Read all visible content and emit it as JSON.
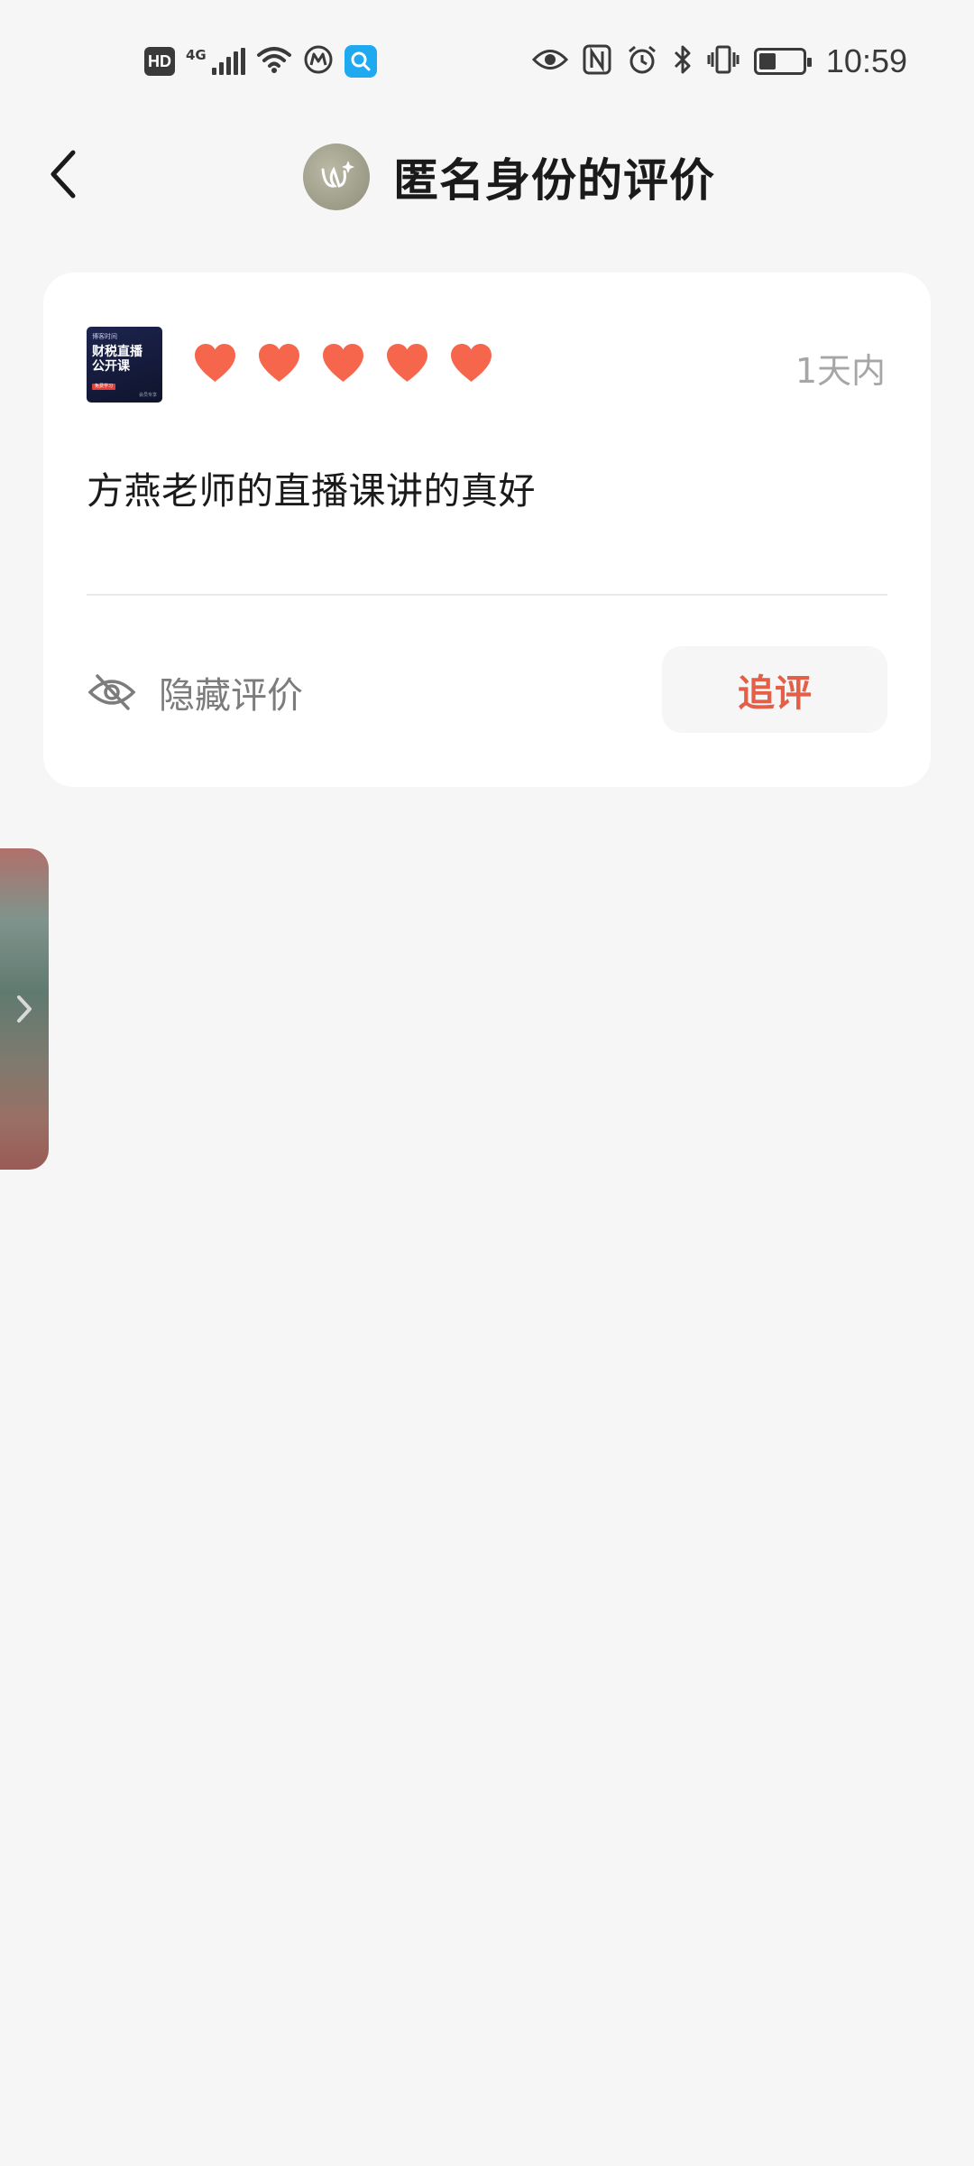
{
  "status_bar": {
    "hd_label": "HD",
    "network_label": "4G",
    "time": "10:59",
    "icons": [
      "hd-icon",
      "signal-icon",
      "wifi-icon",
      "metro-icon",
      "search-app-icon",
      "eye-icon",
      "nfc-icon",
      "alarm-icon",
      "bluetooth-icon",
      "vibrate-icon",
      "battery-icon"
    ],
    "battery_level": 0.4
  },
  "header": {
    "title": "匿名身份的评价",
    "back_icon": "chevron-left-icon",
    "avatar_icon": "anonymous-butterfly-icon"
  },
  "review": {
    "thumbnail": {
      "line1": "博客时间",
      "line2": "财税直播",
      "line3": "公开课",
      "tag": "免费学习",
      "footer": "会员专享"
    },
    "rating": 5,
    "rating_max": 5,
    "time_ago": "1天内",
    "text": "方燕老师的直播课讲的真好",
    "hide_label": "隐藏评价",
    "followup_label": "追评"
  },
  "colors": {
    "accent": "#e35f48",
    "heart": "#f6664c",
    "background": "#f6f6f6",
    "card": "#ffffff"
  }
}
